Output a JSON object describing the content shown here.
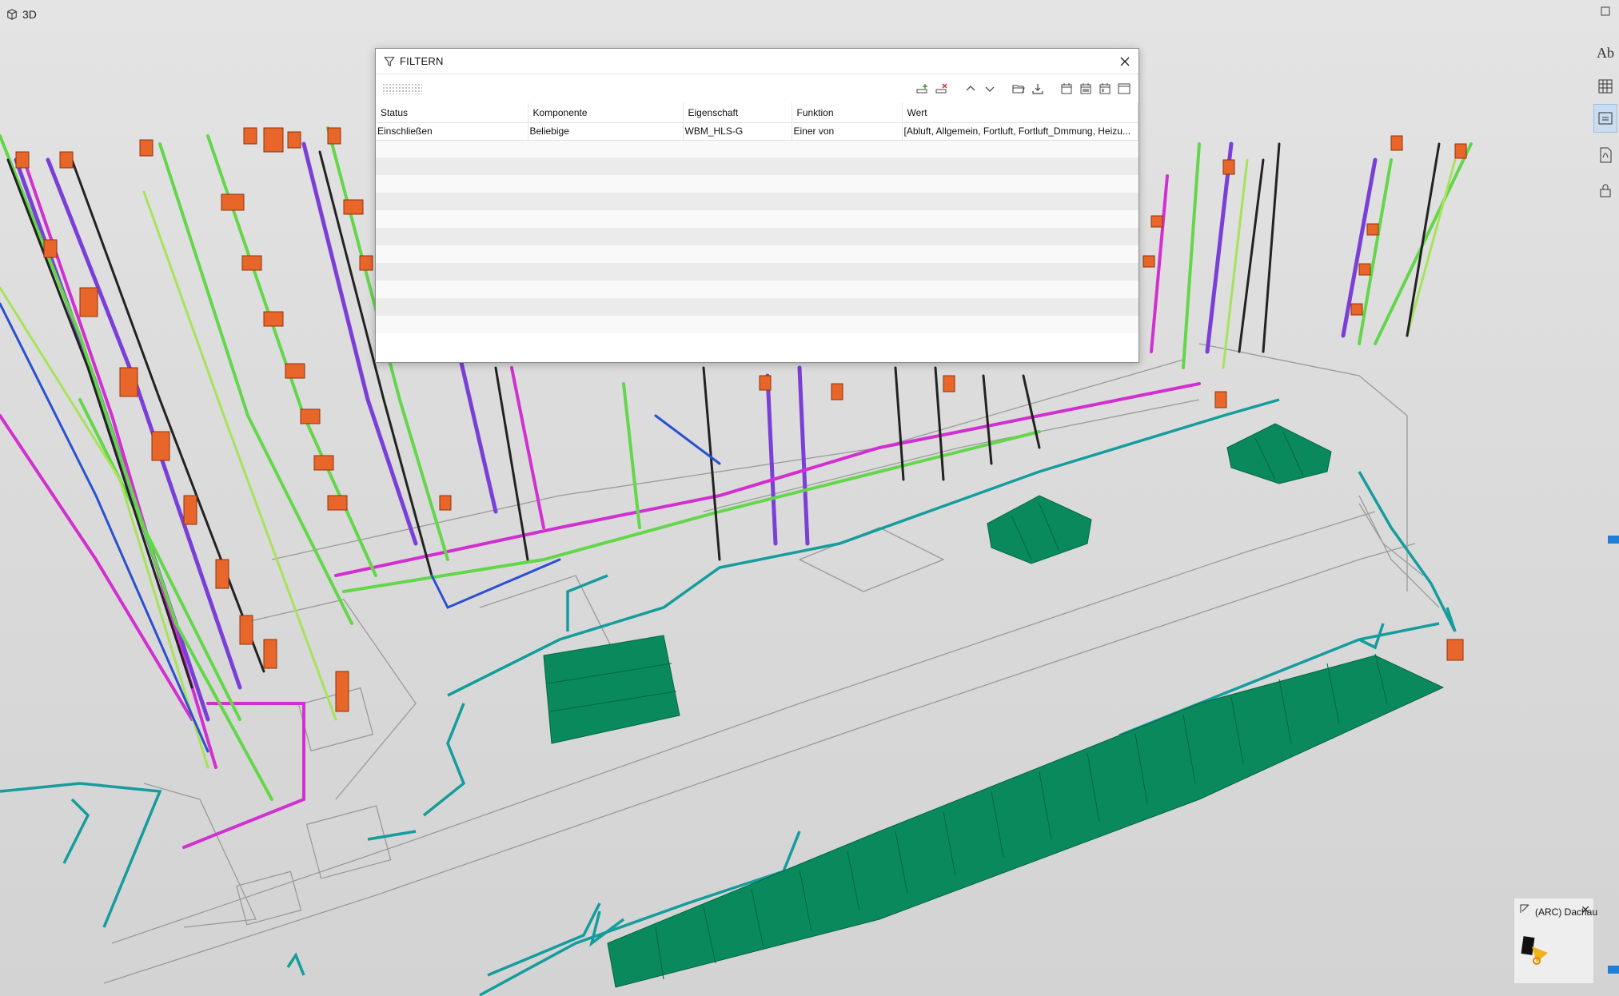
{
  "viewport": {
    "label": "3D",
    "icon": "cube-icon"
  },
  "dialog": {
    "title": "FILTERN",
    "close_icon": "close-icon",
    "toolbar": [
      {
        "name": "add-row-icon"
      },
      {
        "name": "remove-row-icon"
      },
      {
        "name": "move-up-icon"
      },
      {
        "name": "move-down-icon"
      },
      {
        "name": "open-folder-icon"
      },
      {
        "name": "save-download-icon"
      },
      {
        "name": "calendar-icon-1"
      },
      {
        "name": "calendar-icon-2"
      },
      {
        "name": "calendar-icon-3"
      },
      {
        "name": "window-icon"
      }
    ],
    "columns": [
      "Status",
      "Komponente",
      "Eigenschaft",
      "Funktion",
      "Wert"
    ],
    "rows": [
      {
        "status": "Einschließen",
        "komponente": "Beliebige",
        "eigenschaft": "WBM_HLS-G",
        "funktion": "Einer von",
        "wert": "[Abluft, Allgemein, Fortluft, Fortluft_Dmmung, Heizu..."
      }
    ]
  },
  "right_rail": [
    {
      "name": "text-tool-icon",
      "glyph": "Ab"
    },
    {
      "name": "grid-icon"
    },
    {
      "name": "compare-icon"
    },
    {
      "name": "pdf-icon"
    },
    {
      "name": "lock-icon"
    }
  ],
  "mini_panel": {
    "title": "(ARC) Dachau"
  },
  "colors": {
    "purple_pipe": "#7a3fd6",
    "magenta_pipe": "#d22fd0",
    "green_pipe": "#64d64a",
    "lime_pipe": "#a6e35a",
    "teal_pipe": "#159c9c",
    "dark_pipe": "#222222",
    "orange_box": "#e8662a",
    "green_block": "#0a8a5c",
    "floor_lines": "#9a9a9a"
  }
}
